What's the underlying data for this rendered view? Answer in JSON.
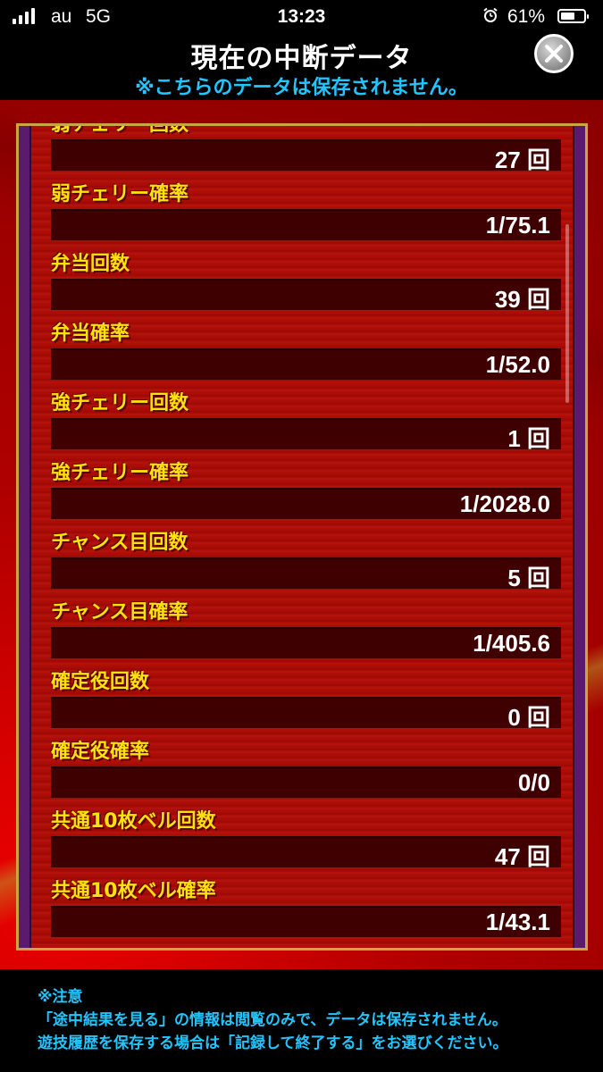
{
  "status_bar": {
    "carrier": "au",
    "network": "5G",
    "time": "13:23",
    "battery_percent": "61%",
    "battery_level": 0.61
  },
  "header": {
    "title": "現在の中断データ",
    "subtitle": "※こちらのデータは保存されません。"
  },
  "rows": [
    {
      "label": "弱チェリー回数",
      "value": "27 回"
    },
    {
      "label": "弱チェリー確率",
      "value": "1/75.1"
    },
    {
      "label": "弁当回数",
      "value": "39 回"
    },
    {
      "label": "弁当確率",
      "value": "1/52.0"
    },
    {
      "label": "強チェリー回数",
      "value": "1 回"
    },
    {
      "label": "強チェリー確率",
      "value": "1/2028.0"
    },
    {
      "label": "チャンス目回数",
      "value": "5 回"
    },
    {
      "label": "チャンス目確率",
      "value": "1/405.6"
    },
    {
      "label": "確定役回数",
      "value": "0 回"
    },
    {
      "label": "確定役確率",
      "value": "0/0"
    },
    {
      "label": "共通10枚ベル回数",
      "value": "47 回"
    },
    {
      "label": "共通10枚ベル確率",
      "value": "1/43.1"
    }
  ],
  "footer": {
    "note_title": "※注意",
    "line1": "「途中結果を見る」の情報は閲覧のみで、データは保存されません。",
    "line2": "遊技履歴を保存する場合は「記録して終了する」をお選びください。"
  },
  "colors": {
    "label_yellow": "#ffe20a",
    "accent_cyan": "#22c6ff",
    "panel_red": "#a80a06",
    "frame_gold": "#c9a544"
  }
}
